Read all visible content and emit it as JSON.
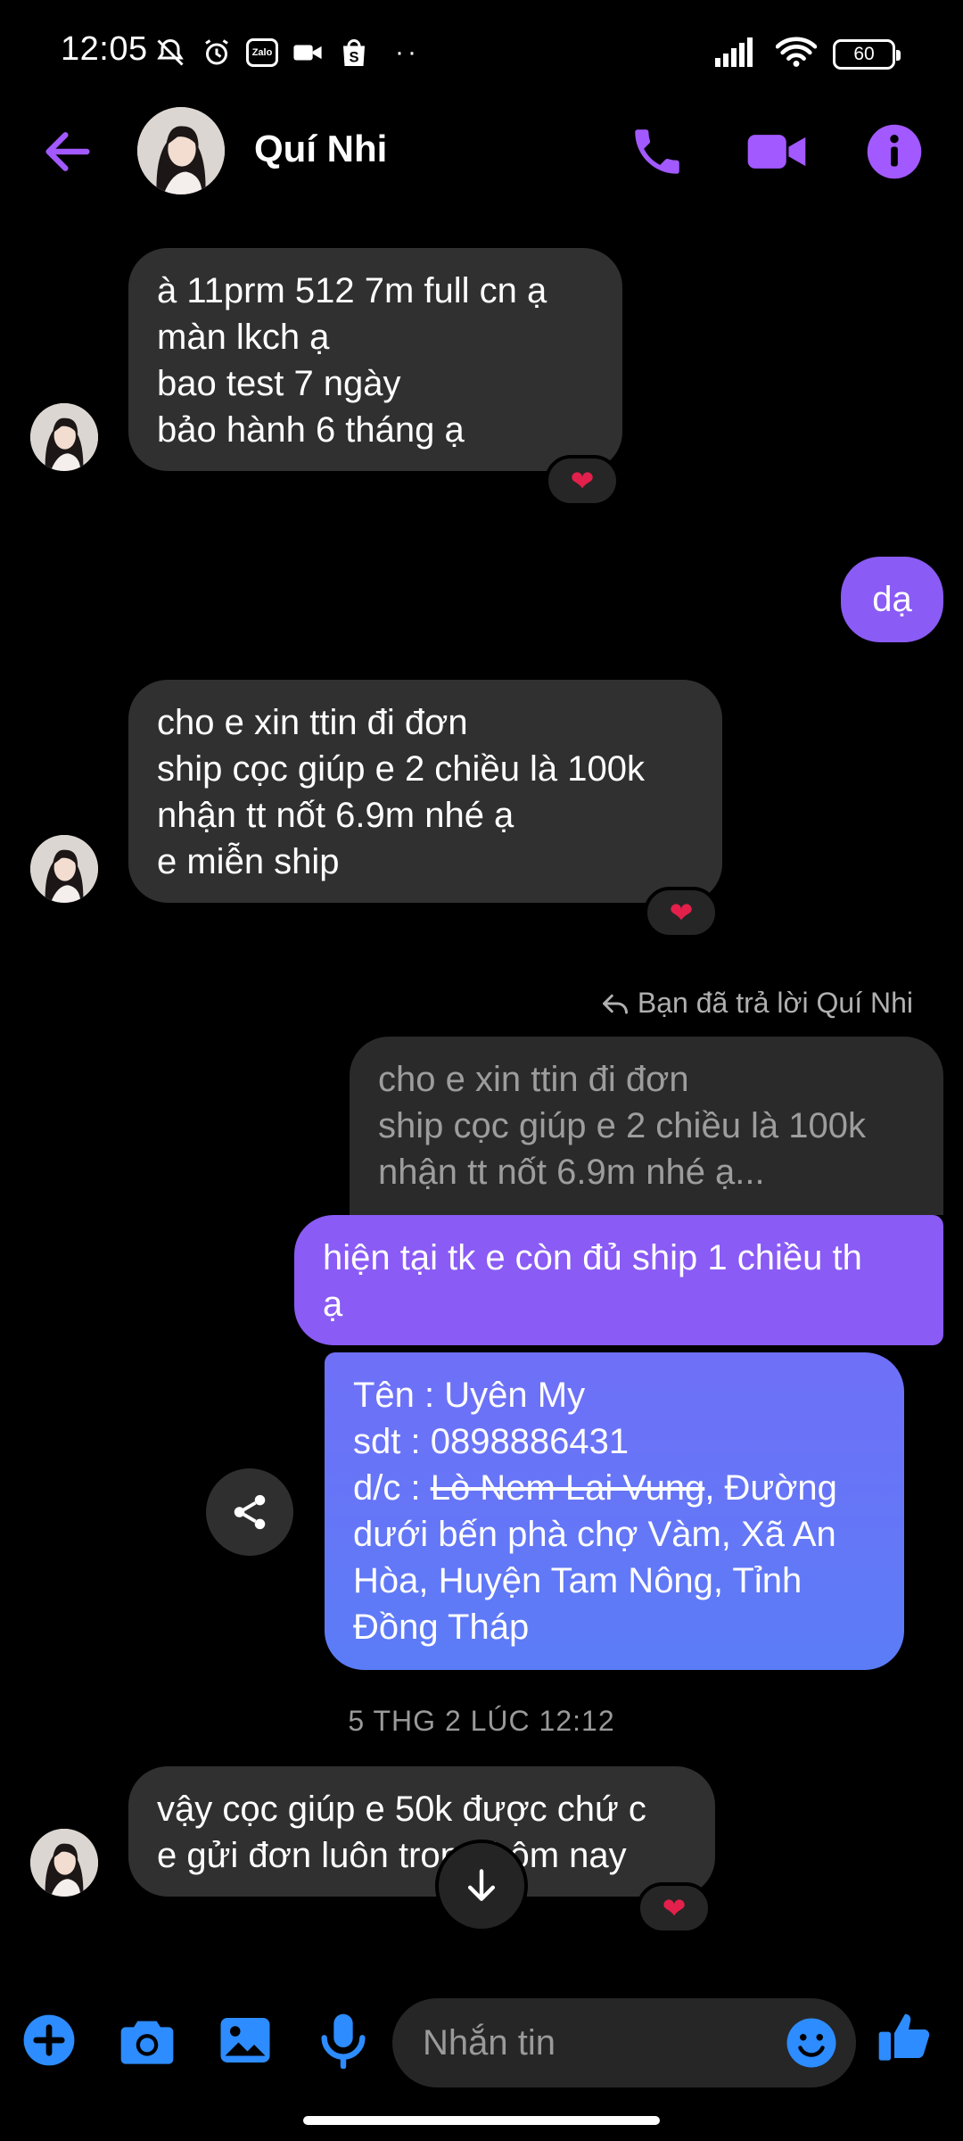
{
  "status": {
    "time": "12:05",
    "battery": "60",
    "zalo": "Zalo"
  },
  "header": {
    "contact_name": "Quí Nhi"
  },
  "messages": {
    "m1": "à 11prm 512 7m full cn ạ\nmàn lkch ạ\nbao test 7 ngày\nbảo hành 6 tháng ạ",
    "m2": "dạ",
    "m3": "cho e xin ttin đi đơn\nship cọc giúp e 2 chiều là 100k\nnhận tt nốt 6.9m nhé ạ\ne miễn ship",
    "reply_label": "Bạn đã trả lời Quí Nhi",
    "quoted": "cho e xin ttin đi đơn\nship cọc giúp e 2 chiều là 100k\nnhận tt nốt 6.9m nhé ạ...",
    "m4": "hiện tại tk e còn đủ ship 1 chiều th\nạ",
    "m5_line1": "Tên : Uyên My",
    "m5_line2": "sdt : 0898886431",
    "m5_prefix": "d/c : ",
    "m5_struck": "Lò Nem Lai Vung",
    "m5_rest": ", Đường dưới bến phà chợ Vàm, Xã An Hòa, Huyện Tam Nông, Tỉnh Đồng Tháp",
    "timestamp": "5 THG 2 LÚC 12:12",
    "m6": "vậy cọc giúp e 50k được chứ c\ne gửi đơn luôn trong hôm nay"
  },
  "composer": {
    "placeholder": "Nhắn tin"
  },
  "colors": {
    "accent": "#a259ff",
    "outgoing_top": "#8a5bf5",
    "outgoing_bottom": "#5b7cf7",
    "incoming": "#303030",
    "heart": "#e3204b"
  }
}
